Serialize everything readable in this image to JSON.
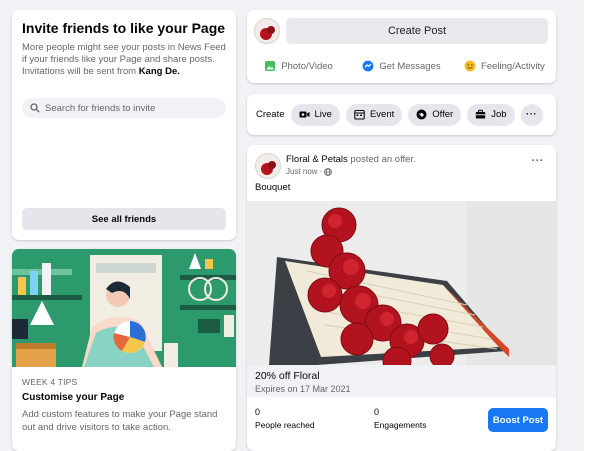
{
  "invite": {
    "title": "Invite friends to like your Page",
    "desc_line": "More people might see your posts in News Feed if your friends like your Page and share posts. Invitations will be sent from ",
    "sender": "Kang De.",
    "search_placeholder": "Search for friends to invite",
    "see_all_label": "See all friends"
  },
  "tips": {
    "week": "WEEK 4 TIPS",
    "title": "Customise your Page",
    "desc": "Add custom features to make your Page stand out and drive visitors to take action."
  },
  "create_post": {
    "button_label": "Create Post",
    "actions": [
      {
        "label": "Photo/Video",
        "icon": "photo-icon"
      },
      {
        "label": "Get Messages",
        "icon": "messenger-icon"
      },
      {
        "label": "Feeling/Activity",
        "icon": "smiley-icon"
      }
    ]
  },
  "create_bar": {
    "label": "Create",
    "chips": [
      {
        "label": "Live",
        "icon": "live-video-icon"
      },
      {
        "label": "Event",
        "icon": "calendar-icon"
      },
      {
        "label": "Offer",
        "icon": "offer-tag-icon"
      },
      {
        "label": "Job",
        "icon": "briefcase-icon"
      }
    ],
    "more_label": "···"
  },
  "post": {
    "page_name": "Floral & Petals",
    "action_text": " posted an offer.",
    "timestamp": "Just now ·",
    "menu_label": "···",
    "caption": "Bouquet",
    "offer_title": "20% off Floral",
    "offer_expiry": "Expires on 17 Mar 2021",
    "stats": [
      {
        "value": "0",
        "label": "People reached"
      },
      {
        "value": "0",
        "label": "Engagements"
      }
    ],
    "boost_label": "Boost Post"
  },
  "colors": {
    "accent": "#1877f2",
    "page_bg": "#f0f2f5",
    "flower_red": "#b3131e",
    "tips_green": "#2d9a6e"
  }
}
